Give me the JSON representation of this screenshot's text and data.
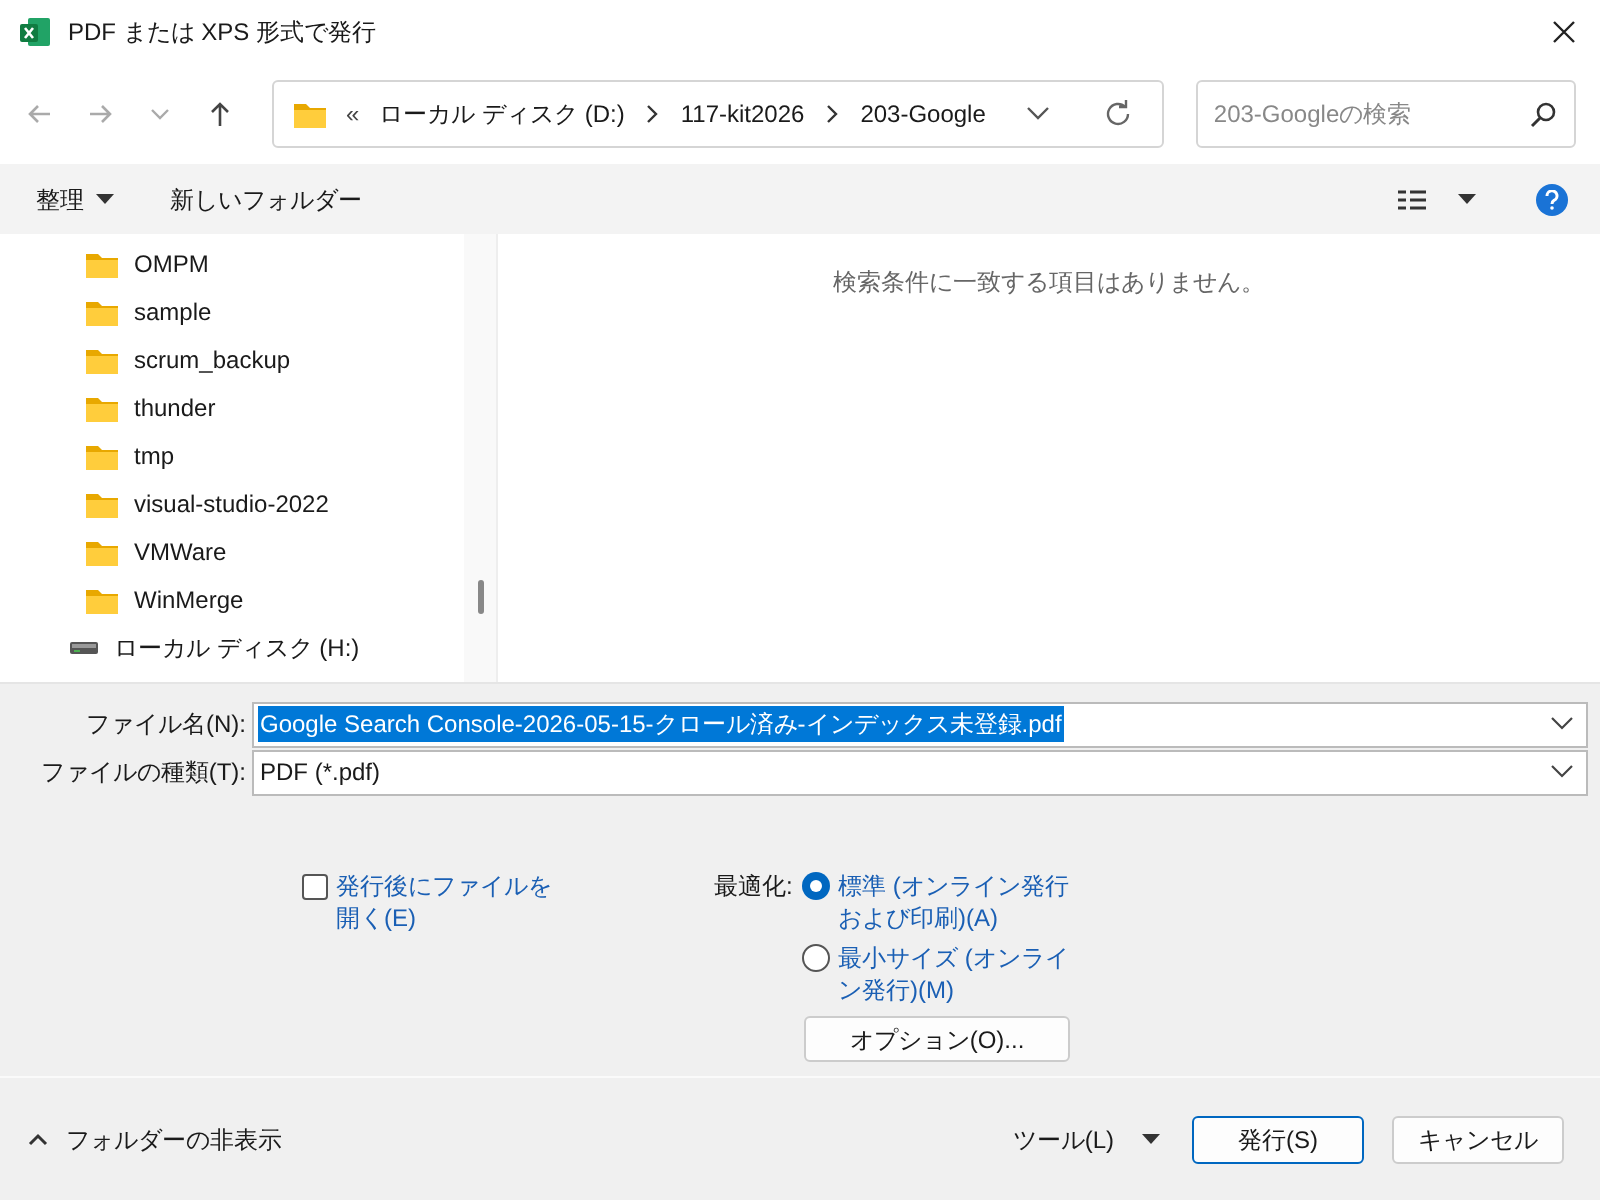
{
  "window": {
    "title": "PDF または XPS 形式で発行"
  },
  "address_bar": {
    "overflow": "«",
    "crumbs": [
      "ローカル ディスク (D:)",
      "117-kit2026",
      "203-Google"
    ]
  },
  "search": {
    "placeholder": "203-Googleの検索"
  },
  "toolbar": {
    "organize": "整理",
    "new_folder": "新しいフォルダー"
  },
  "tree": [
    {
      "kind": "folder",
      "label": "OMPM"
    },
    {
      "kind": "folder",
      "label": "sample"
    },
    {
      "kind": "folder",
      "label": "scrum_backup"
    },
    {
      "kind": "folder",
      "label": "thunder"
    },
    {
      "kind": "folder",
      "label": "tmp"
    },
    {
      "kind": "folder",
      "label": "visual-studio-2022"
    },
    {
      "kind": "folder",
      "label": "VMWare"
    },
    {
      "kind": "folder",
      "label": "WinMerge"
    },
    {
      "kind": "drive",
      "label": "ローカル ディスク (H:)"
    }
  ],
  "empty_message": "検索条件に一致する項目はありません。",
  "file_name": {
    "label": "ファイル名(N):",
    "value": "Google Search Console-2026-05-15-クロール済み-インデックス未登録.pdf"
  },
  "file_type": {
    "label": "ファイルの種類(T):",
    "value": "PDF (*.pdf)"
  },
  "open_after": {
    "label": "発行後にファイルを開く(E)",
    "checked": false
  },
  "optimize": {
    "label": "最適化:",
    "options": [
      {
        "label": "標準 (オンライン発行および印刷)(A)",
        "selected": true
      },
      {
        "label": "最小サイズ (オンライン発行)(M)",
        "selected": false
      }
    ]
  },
  "options_button": "オプション(O)...",
  "hide_folders": "フォルダーの非表示",
  "tools": "ツール(L)",
  "buttons": [
    {
      "label": "発行(S)",
      "kind": "primary"
    },
    {
      "label": "キャンセル",
      "kind": "secondary"
    }
  ]
}
